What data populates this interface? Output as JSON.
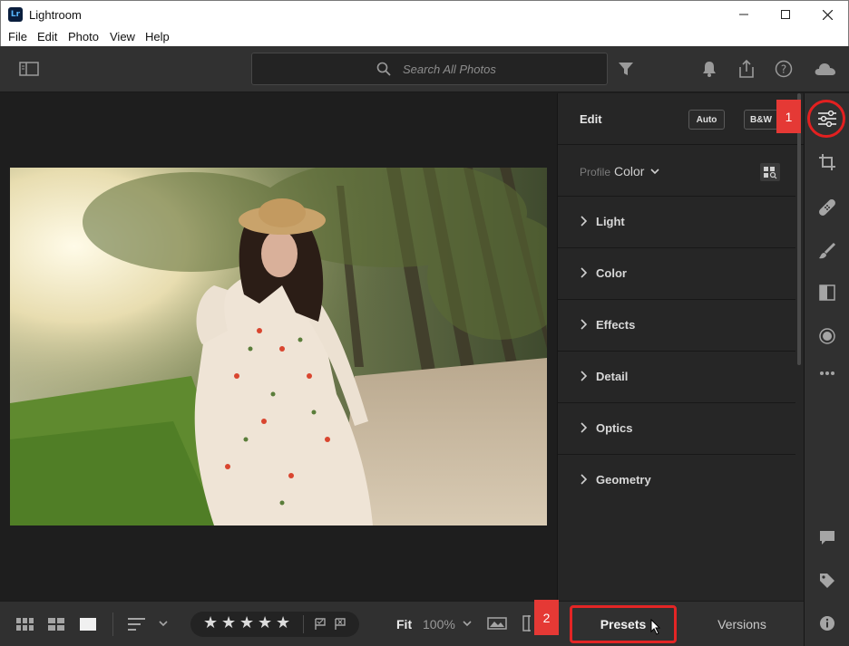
{
  "window": {
    "app_logo_text": "Lr",
    "title": "Lightroom"
  },
  "menu": [
    "File",
    "Edit",
    "Photo",
    "View",
    "Help"
  ],
  "toolbar": {
    "search_placeholder": "Search All Photos"
  },
  "edit_panel": {
    "title": "Edit",
    "auto_label": "Auto",
    "bw_label": "B&W",
    "profile_label": "Profile",
    "profile_value": "Color",
    "sections": [
      "Light",
      "Color",
      "Effects",
      "Detail",
      "Optics",
      "Geometry"
    ]
  },
  "bottom": {
    "rating_stars": 5,
    "fit_label": "Fit",
    "zoom_label": "100%",
    "tabs": {
      "presets": "Presets",
      "versions": "Versions"
    }
  },
  "annotations": {
    "badge_1": "1",
    "badge_2": "2"
  },
  "colors": {
    "highlight": "#e32525",
    "panel": "#262626",
    "toolbar": "#313131"
  }
}
